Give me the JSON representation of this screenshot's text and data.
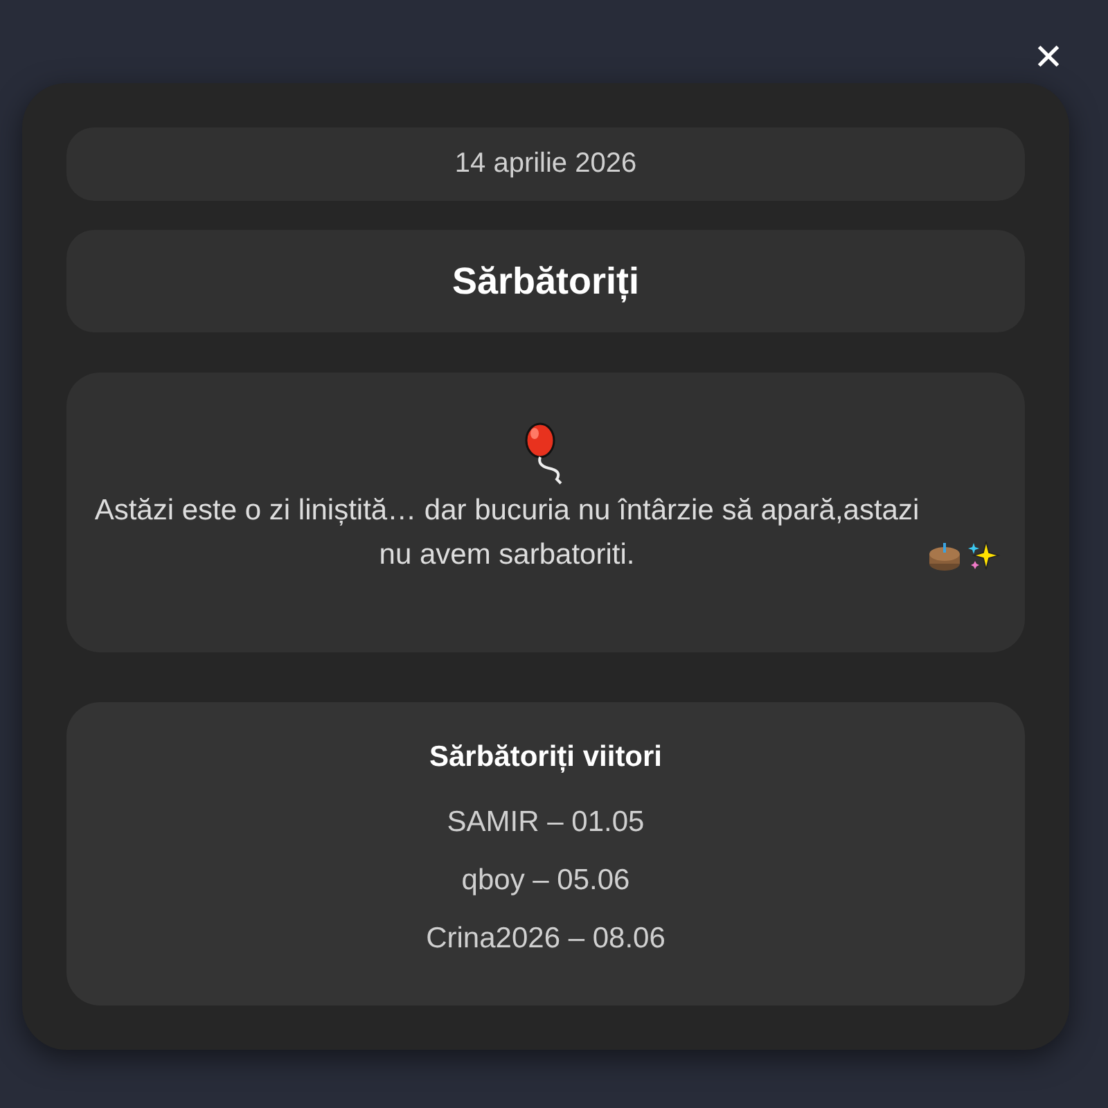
{
  "close_button": {
    "label": "✕"
  },
  "date": "14 aprilie 2026",
  "title": "Sărbătoriți",
  "message": "Astăzi este o zi liniștită… dar bucuria nu întârzie să apară,astazi nu avem sarbatoriti.",
  "upcoming": {
    "title": "Sărbătoriți viitori",
    "items": [
      "SAMIR – 01.05",
      "qboy – 05.06",
      "Crina2026 – 08.06"
    ]
  }
}
